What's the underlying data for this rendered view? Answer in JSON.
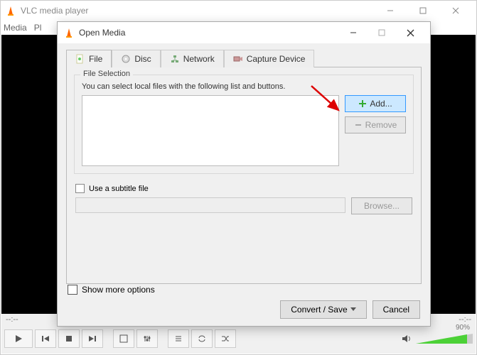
{
  "main": {
    "title": "VLC media player",
    "menu": [
      "Media",
      "Pl"
    ],
    "time_left": "--:--",
    "time_right": "--:--",
    "volume_pct": "90%"
  },
  "dialog": {
    "title": "Open Media",
    "tabs": [
      {
        "icon": "file-icon",
        "label": "File"
      },
      {
        "icon": "disc-icon",
        "label": "Disc"
      },
      {
        "icon": "network-icon",
        "label": "Network"
      },
      {
        "icon": "capture-icon",
        "label": "Capture Device"
      }
    ],
    "file_selection": {
      "group_label": "File Selection",
      "help": "You can select local files with the following list and buttons.",
      "add_label": "Add...",
      "remove_label": "Remove"
    },
    "subtitle": {
      "checkbox_label": "Use a subtitle file",
      "browse_label": "Browse..."
    },
    "show_more_label": "Show more options",
    "convert_label": "Convert / Save",
    "cancel_label": "Cancel"
  }
}
